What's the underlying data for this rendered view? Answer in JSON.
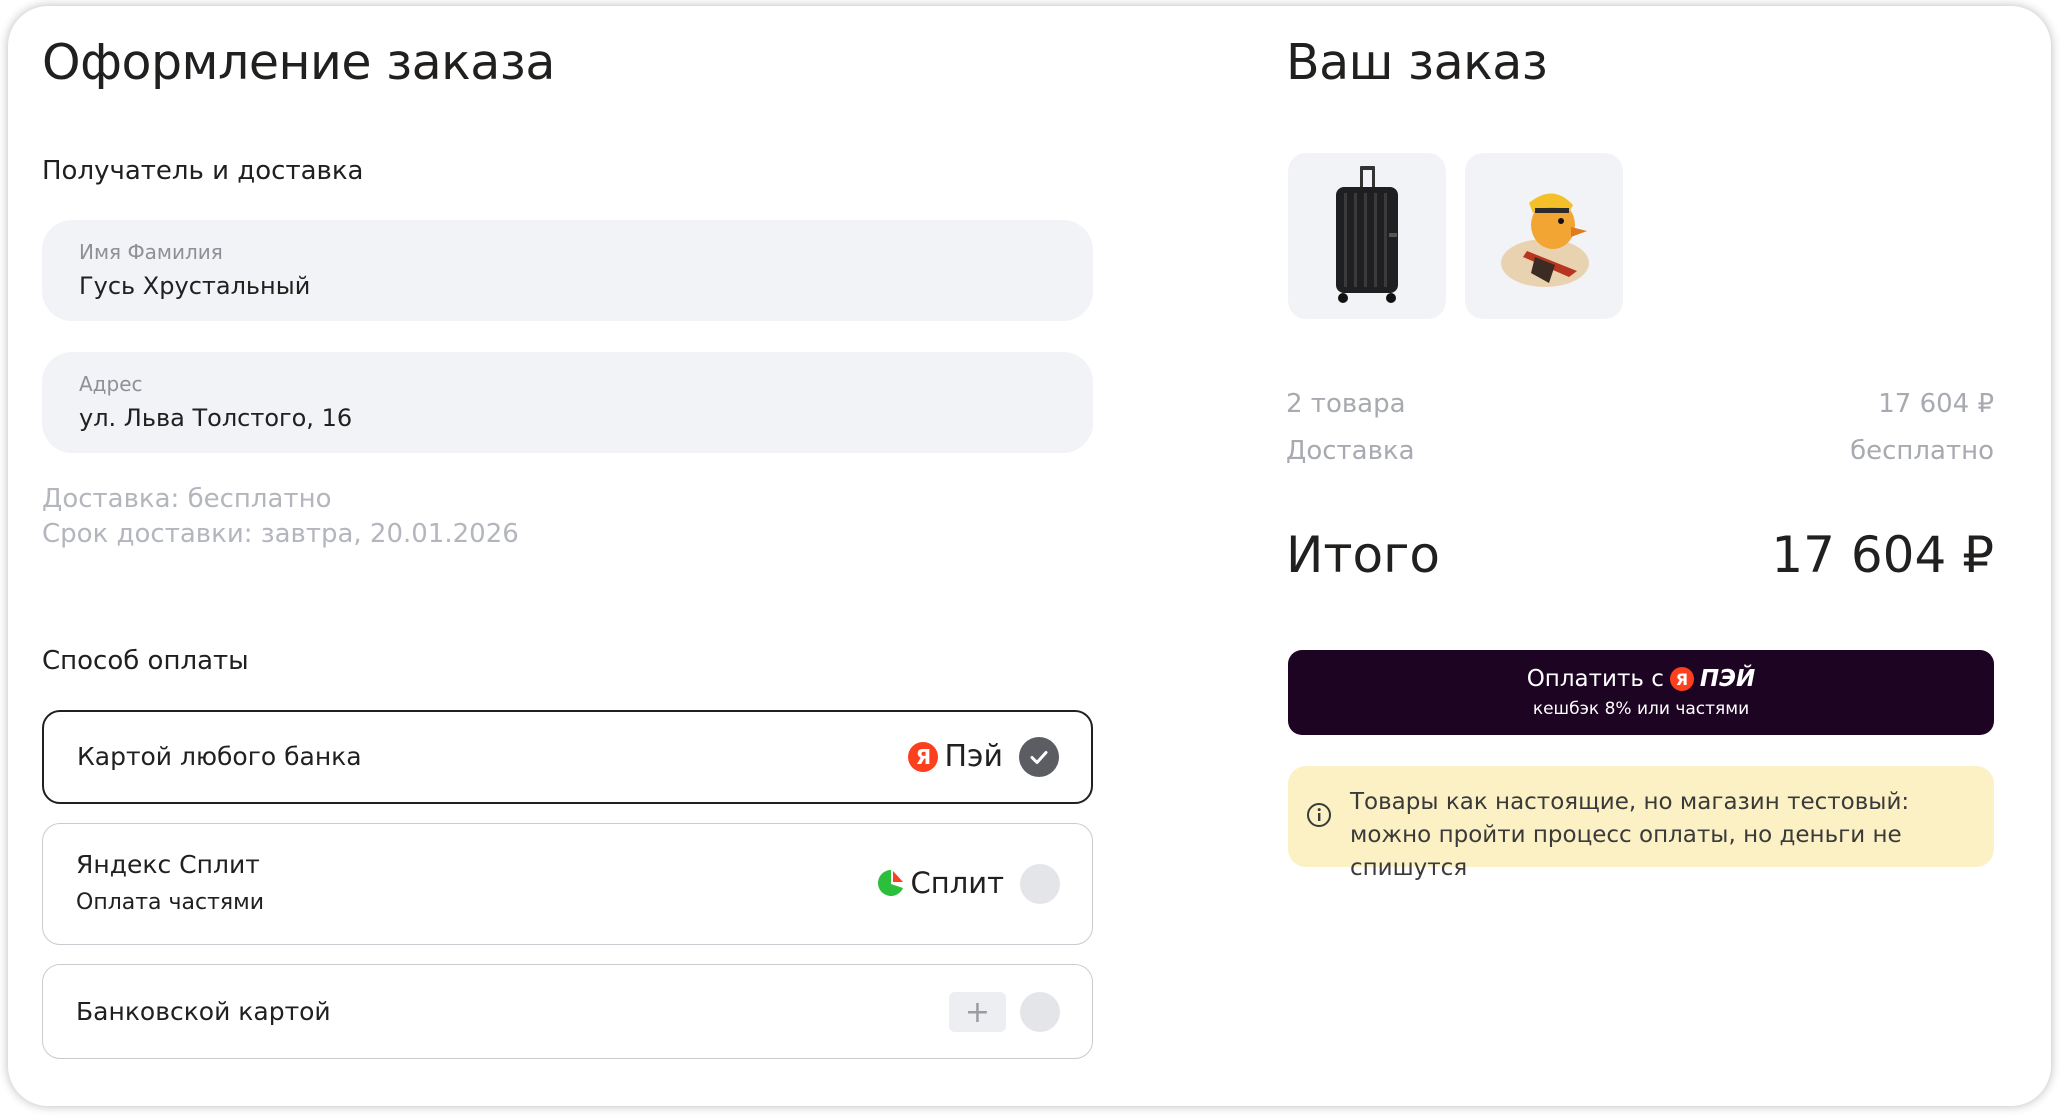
{
  "checkout": {
    "title": "Оформление заказа",
    "recipient_section": "Получатель и доставка",
    "name_field": {
      "label": "Имя Фамилия",
      "value": "Гусь Хрустальный"
    },
    "address_field": {
      "label": "Адрес",
      "value": "ул. Льва Толстого, 16"
    },
    "delivery_cost": "Доставка: бесплатно",
    "delivery_date": "Срок доставки: завтра, 20.01.2026",
    "payment_section": "Способ оплаты",
    "payment_options": [
      {
        "title": "Картой любого банка",
        "subtitle": "",
        "logo": "Пэй",
        "logo_letter": "Я",
        "selected": true
      },
      {
        "title": "Яндекс Сплит",
        "subtitle": "Оплата частями",
        "logo": "Сплит",
        "selected": false
      },
      {
        "title": "Банковской картой",
        "subtitle": "",
        "add_icon": "plus-icon",
        "selected": false
      }
    ]
  },
  "order": {
    "title": "Ваш заказ",
    "items": [
      {
        "icon": "suitcase-image"
      },
      {
        "icon": "rubber-duck-image"
      }
    ],
    "items_count_label": "2 товара",
    "items_price": "17 604 ₽",
    "delivery_label": "Доставка",
    "delivery_value": "бесплатно",
    "total_label": "Итого",
    "total_value": "17 604 ₽",
    "pay_button": {
      "label": "Оплатить с",
      "brand_letter": "Я",
      "brand_name": "ПЭЙ",
      "sub": "кешбэк 8% или  частями"
    },
    "notice": "Товары как настоящие, но магазин тестовый: можно пройти процесс оплаты, но деньги не спишутся"
  },
  "colors": {
    "accent_dark": "#1c0422",
    "field_bg": "#f2f3f6",
    "notice_bg": "#fcf1c5",
    "ya_red": "#fc3f1d",
    "split_green": "#2cbf3b"
  }
}
